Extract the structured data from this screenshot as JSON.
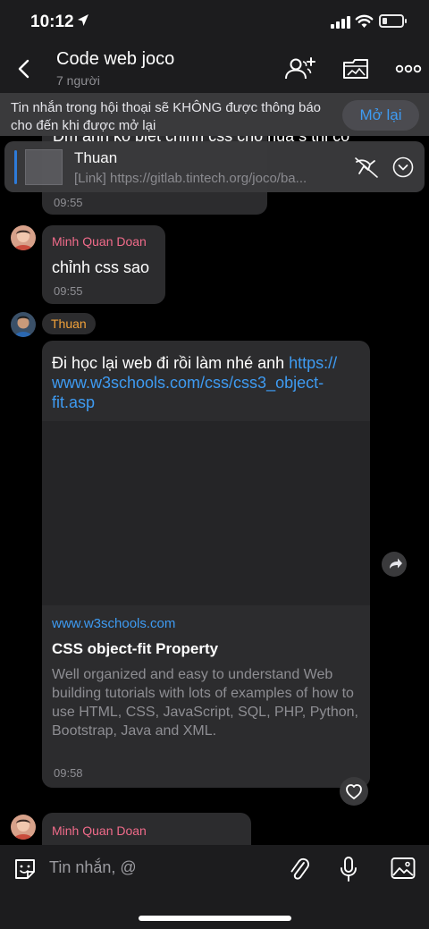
{
  "status_bar": {
    "time": "10:12"
  },
  "header": {
    "title": "Code web joco",
    "members": "7 người",
    "icons": [
      "back-icon",
      "add-member-icon",
      "media-folder-icon",
      "more-icon"
    ]
  },
  "notice": {
    "text": "Tin nhắn trong hội thoại sẽ KHÔNG được thông báo cho đến khi được mở lại",
    "button": "Mở lại"
  },
  "pinned": {
    "name": "Thuan",
    "link": "[Link] https://gitlab.tintech.org/joco/ba...",
    "behind_text": "Dm anh ko biet chinh css cho nua s thi co"
  },
  "messages": [
    {
      "time": "09:55"
    },
    {
      "sender": "Minh Quan Doan",
      "text": "chỉnh css sao",
      "time": "09:55"
    },
    {
      "sender": "Thuan",
      "text_plain": "Đi học lại web đi rồi làm nhé anh ",
      "link_line1": "https://",
      "link_line2": "www.w3schools.com/css/css3_object-",
      "link_line3": "fit.asp",
      "preview": {
        "domain": "www.w3schools.com",
        "title": "CSS object-fit Property",
        "description": "Well organized and easy to understand Web building tutorials with lots of examples of how to use HTML, CSS, JavaScript, SQL, PHP, Python, Bootstrap, Java and XML."
      },
      "time": "09:58"
    },
    {
      "sender": "Minh Quan Doan"
    }
  ],
  "input": {
    "placeholder": "Tin nhắn, @"
  },
  "colors": {
    "accent": "#3e9bf2",
    "sender_minh": "#f06b8a",
    "sender_thuan": "#f2a23a",
    "link": "#3e9bf2"
  }
}
